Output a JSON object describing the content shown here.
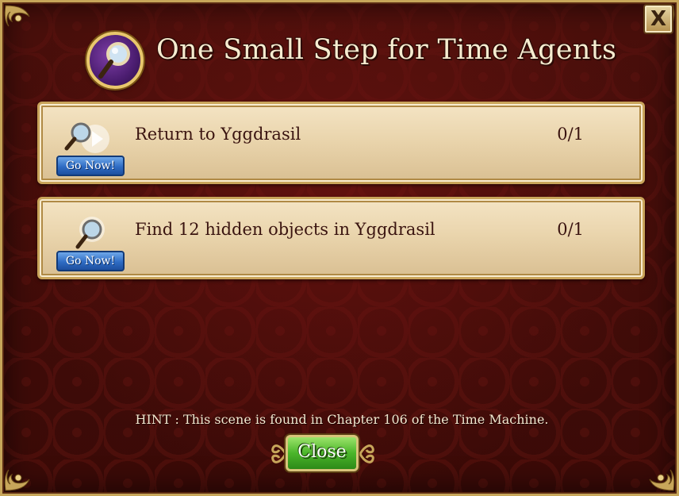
{
  "dialog": {
    "title": "One Small Step for Time Agents",
    "close_x_label": "X",
    "icon": "magnifying-glass-icon"
  },
  "tasks": [
    {
      "label": "Return to Yggdrasil",
      "count": "0/1",
      "button_label": "Go Now!",
      "icon": "magnifying-glass-play-icon"
    },
    {
      "label": "Find 12 hidden objects in Yggdrasil",
      "count": "0/1",
      "button_label": "Go Now!",
      "icon": "magnifying-glass-icon"
    }
  ],
  "hint": "HINT : This scene is found in Chapter 106 of the Time Machine.",
  "close_button_label": "Close",
  "colors": {
    "background": "#3a0a07",
    "frame_gold": "#c7a65a",
    "task_panel": "#ead5ad",
    "go_now_blue": "#2f6cc4",
    "close_green": "#4bb52a"
  }
}
